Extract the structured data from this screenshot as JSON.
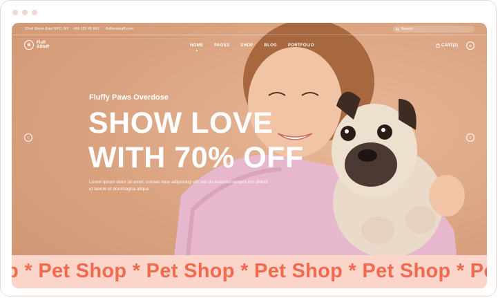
{
  "topbar": {
    "address": "22nd Street East NYC, NY",
    "phone": "+00 123 45 842",
    "email": "fluffandstuff.com",
    "search_placeholder": "Search"
  },
  "brand": {
    "logo_line1": "Fluff",
    "logo_line2": "&Stuff"
  },
  "nav": {
    "items": [
      "HOME",
      "PAGES",
      "SHOP",
      "BLOG",
      "PORTFOLIO"
    ],
    "active": "HOME"
  },
  "cart": {
    "label": "CART(2)"
  },
  "hero": {
    "eyebrow": "Fluffy Paws Overdose",
    "headline_line1": "SHOW LOVE",
    "headline_line2": "WITH 70% OFF",
    "description": "Lorem ipsum dolor sit amet, consec tetur adipiscing elit sed do eiusmod tempor inci didunt ut labore et doremagna aliqua"
  },
  "banner": {
    "text": "p * Pet Shop * Pet Shop * Pet Shop * Pet Shop * Pet Shop"
  },
  "colors": {
    "accent": "#ef6a4f",
    "banner_bg": "#fbd5c9",
    "hero_bg": "#d9a27f"
  }
}
